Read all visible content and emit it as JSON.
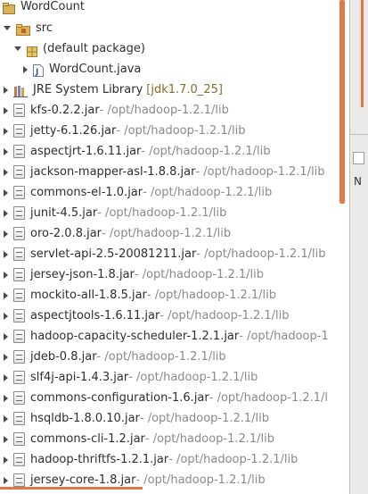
{
  "project": {
    "name": "WordCount"
  },
  "src": {
    "label": "src"
  },
  "package": {
    "label": "(default package)"
  },
  "file": {
    "label": "WordCount.java"
  },
  "jre": {
    "label": "JRE System Library",
    "version": "[jdk1.7.0_25]"
  },
  "jars": [
    {
      "name": "kfs-0.2.2.jar",
      "path": " - /opt/hadoop-1.2.1/lib"
    },
    {
      "name": "jetty-6.1.26.jar",
      "path": " - /opt/hadoop-1.2.1/lib"
    },
    {
      "name": "aspectjrt-1.6.11.jar",
      "path": " - /opt/hadoop-1.2.1/lib"
    },
    {
      "name": "jackson-mapper-asl-1.8.8.jar",
      "path": " - /opt/hadoop-1.2.1/lib"
    },
    {
      "name": "commons-el-1.0.jar",
      "path": " - /opt/hadoop-1.2.1/lib"
    },
    {
      "name": "junit-4.5.jar",
      "path": " - /opt/hadoop-1.2.1/lib"
    },
    {
      "name": "oro-2.0.8.jar",
      "path": " - /opt/hadoop-1.2.1/lib"
    },
    {
      "name": "servlet-api-2.5-20081211.jar",
      "path": " - /opt/hadoop-1.2.1/lib"
    },
    {
      "name": "jersey-json-1.8.jar",
      "path": " - /opt/hadoop-1.2.1/lib"
    },
    {
      "name": "mockito-all-1.8.5.jar",
      "path": " - /opt/hadoop-1.2.1/lib"
    },
    {
      "name": "aspectjtools-1.6.11.jar",
      "path": " - /opt/hadoop-1.2.1/lib"
    },
    {
      "name": "hadoop-capacity-scheduler-1.2.1.jar",
      "path": " - /opt/hadoop-1"
    },
    {
      "name": "jdeb-0.8.jar",
      "path": " - /opt/hadoop-1.2.1/lib"
    },
    {
      "name": "slf4j-api-1.4.3.jar",
      "path": " - /opt/hadoop-1.2.1/lib"
    },
    {
      "name": "commons-configuration-1.6.jar",
      "path": " - /opt/hadoop-1.2.1/l"
    },
    {
      "name": "hsqldb-1.8.0.10.jar",
      "path": " - /opt/hadoop-1.2.1/lib"
    },
    {
      "name": "commons-cli-1.2.jar",
      "path": " - /opt/hadoop-1.2.1/lib"
    },
    {
      "name": "hadoop-thriftfs-1.2.1.jar",
      "path": " - /opt/hadoop-1.2.1/lib"
    },
    {
      "name": "jersey-core-1.8.jar",
      "path": " - /opt/hadoop-1.2.1/lib"
    }
  ],
  "side_panel": {
    "label": "N"
  },
  "colors": {
    "accent": "#e07a45",
    "path_text": "#8a8a8a"
  }
}
